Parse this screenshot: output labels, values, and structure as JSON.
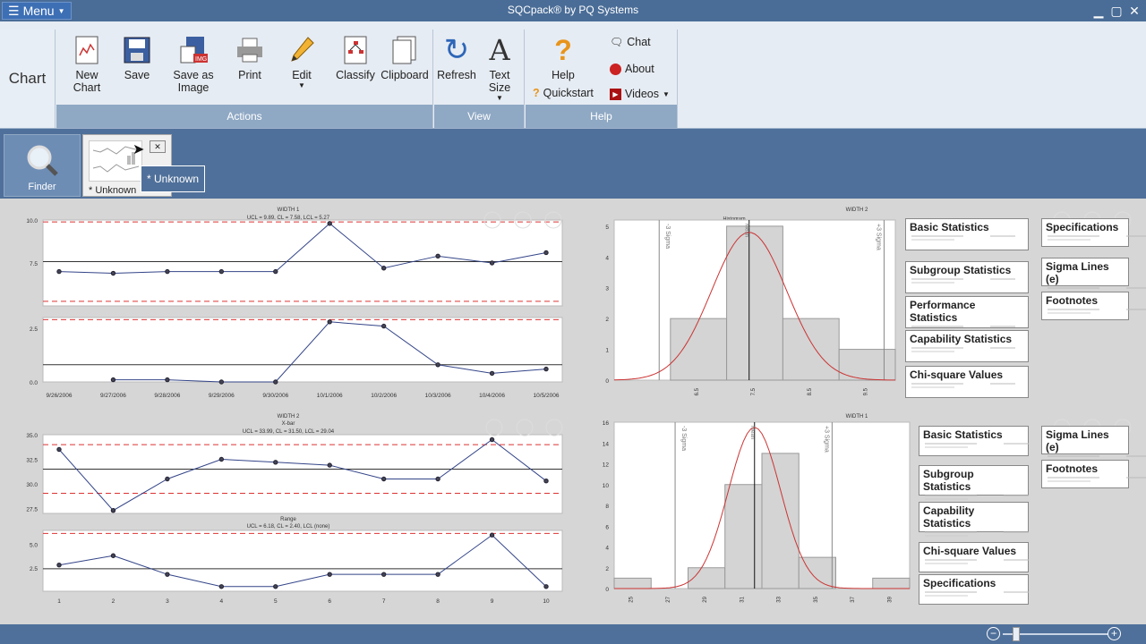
{
  "titlebar": {
    "menu": "Menu",
    "title": "SQCpack® by PQ Systems"
  },
  "ribbon": {
    "tab": "Chart",
    "actions": {
      "label": "Actions",
      "buttons": [
        "New Chart",
        "Save",
        "Save as Image",
        "Print",
        "Edit",
        "Classify",
        "Clipboard"
      ]
    },
    "view": {
      "label": "View",
      "buttons": [
        "Refresh",
        "Text Size"
      ]
    },
    "help": {
      "label": "Help",
      "help": "Help",
      "quickstart": "Quickstart",
      "chat": "Chat",
      "about": "About",
      "videos": "Videos"
    }
  },
  "workspace": {
    "finder": "Finder",
    "doc_tab": "* Unknown",
    "tooltip": "* Unknown"
  },
  "charts": {
    "width1": {
      "title": "WIDTH 1",
      "subtitle": "UCL = 9.89, CL = 7.58, LCL = 5.27",
      "dates": [
        "9/26/2006",
        "9/27/2006",
        "9/28/2006",
        "9/29/2006",
        "9/30/2006",
        "10/1/2006",
        "10/2/2006",
        "10/3/2006",
        "10/4/2006",
        "10/5/2006"
      ],
      "x_ticks": [
        "10.0",
        "7.5",
        "2.5",
        "0.0"
      ]
    },
    "width2": {
      "title": "WIDTH 2",
      "xbar_label": "X-bar",
      "subtitle": "UCL = 33.99, CL = 31.50, LCL = 29.04",
      "range_label": "Range",
      "range_subtitle": "UCL = 6.18, CL = 2.40, LCL (none)",
      "xbar_ticks": [
        "35.0",
        "32.5",
        "30.0",
        "27.5"
      ],
      "range_ticks": [
        "5.0",
        "2.5"
      ],
      "x_labels": [
        "1",
        "2",
        "3",
        "4",
        "5",
        "6",
        "7",
        "8",
        "9",
        "10"
      ]
    },
    "hist_top": {
      "title": "WIDTH 2",
      "subtitle": "Histogram",
      "x_ticks": [
        "6.5",
        "7.5",
        "8.5",
        "9.5"
      ],
      "y_ticks": [
        "5",
        "4",
        "3",
        "2",
        "1",
        "0"
      ],
      "minus3": "-3 Sigma",
      "plus3": "+3 Sigma",
      "mean": "Mean"
    },
    "hist_bottom": {
      "title": "WIDTH 1",
      "x_ticks": [
        "25",
        "27",
        "29",
        "31",
        "33",
        "35",
        "37",
        "39"
      ],
      "y_ticks": [
        "16",
        "14",
        "12",
        "10",
        "8",
        "6",
        "4",
        "2",
        "0"
      ],
      "minus3": "-3 Sigma",
      "plus3": "+3 Sigma",
      "mean": "Mean"
    }
  },
  "stats_top": [
    "Basic Statistics",
    "Subgroup Statistics",
    "Performance Statistics",
    "Capability Statistics",
    "Chi-square Values"
  ],
  "stats_top_right": [
    "Specifications",
    "Sigma Lines (e)",
    "Footnotes"
  ],
  "stats_bottom": [
    "Basic Statistics",
    "Subgroup Statistics",
    "Capability Statistics",
    "Chi-square Values",
    "Specifications"
  ],
  "stats_bottom_right": [
    "Sigma Lines (e)",
    "Footnotes"
  ],
  "chart_data": [
    {
      "type": "line",
      "title": "WIDTH 1",
      "x": [
        "9/26/2006",
        "9/27/2006",
        "9/28/2006",
        "9/29/2006",
        "9/30/2006",
        "10/1/2006",
        "10/2/2006",
        "10/3/2006",
        "10/4/2006",
        "10/5/2006"
      ],
      "series": [
        {
          "values": [
            7.0,
            6.9,
            7.0,
            7.0,
            7.0,
            9.8,
            7.2,
            7.9,
            7.5,
            8.1
          ]
        }
      ],
      "ylim": [
        5,
        10
      ]
    },
    {
      "type": "line",
      "x": [
        "9/26/2006",
        "9/27/2006",
        "9/28/2006",
        "9/29/2006",
        "9/30/2006",
        "10/1/2006",
        "10/2/2006",
        "10/3/2006",
        "10/4/2006",
        "10/5/2006"
      ],
      "series": [
        {
          "values": [
            null,
            0.1,
            0.1,
            0.0,
            0.0,
            2.8,
            2.6,
            0.8,
            0.4,
            0.6
          ]
        }
      ],
      "ylim": [
        0,
        3
      ]
    },
    {
      "type": "line",
      "title": "WIDTH 2",
      "x": [
        "1",
        "2",
        "3",
        "4",
        "5",
        "6",
        "7",
        "8",
        "9",
        "10"
      ],
      "series": [
        {
          "values": [
            33.5,
            27.3,
            30.5,
            32.5,
            32.2,
            31.9,
            30.5,
            30.5,
            34.5,
            30.3
          ]
        }
      ],
      "ylim": [
        27,
        35
      ]
    },
    {
      "type": "line",
      "x": [
        "1",
        "2",
        "3",
        "4",
        "5",
        "6",
        "7",
        "8",
        "9",
        "10"
      ],
      "series": [
        {
          "values": [
            2.8,
            3.8,
            1.8,
            0.5,
            0.5,
            1.8,
            1.8,
            1.8,
            6.0,
            0.5
          ]
        }
      ],
      "ylim": [
        0,
        6.5
      ]
    },
    {
      "type": "bar",
      "title": "WIDTH 2",
      "categories": [
        "6.5",
        "7.5",
        "8.5",
        "9.5"
      ],
      "values": [
        2,
        5,
        2,
        1
      ],
      "ylim": [
        0,
        5
      ]
    },
    {
      "type": "bar",
      "title": "WIDTH 1",
      "categories": [
        "25",
        "29",
        "31",
        "33",
        "35",
        "39"
      ],
      "values": [
        1,
        2,
        10,
        13,
        3,
        1
      ],
      "ylim": [
        0,
        16
      ]
    }
  ],
  "status": {
    "zoom_label": "zoom"
  }
}
